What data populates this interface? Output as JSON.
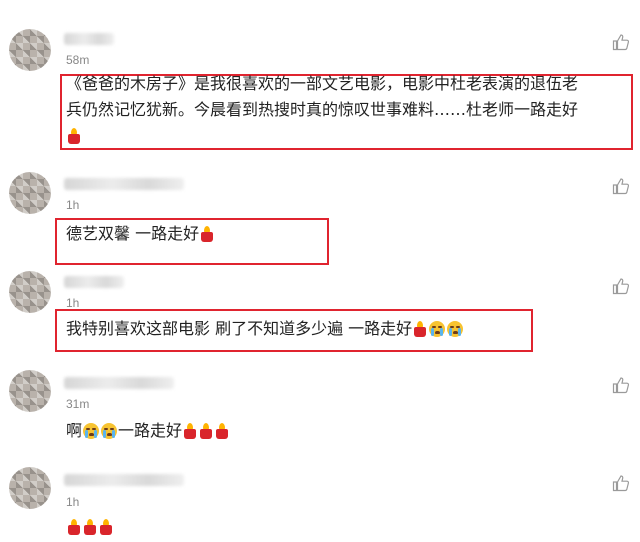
{
  "comments": [
    {
      "time": "58m",
      "lines": [
        "《爸爸的木房子》是我很喜欢的一部文艺电影，电影中杜老表演的退伍老",
        "兵仍然记忆犹新。今晨看到热搜时真的惊叹世事难料……杜老师一路走好"
      ],
      "emoji": [
        "candle"
      ]
    },
    {
      "time": "1h",
      "text": "德艺双馨 一路走好",
      "emoji": [
        "candle"
      ]
    },
    {
      "time": "1h",
      "text": "我特别喜欢这部电影 刷了不知道多少遍 一路走好",
      "emoji": [
        "candle",
        "crying-face",
        "crying-face"
      ]
    },
    {
      "time": "31m",
      "text_prefix": "啊",
      "text": "一路走好",
      "emoji_before": [
        "crying-face",
        "crying-face"
      ],
      "emoji": [
        "candle",
        "candle",
        "candle"
      ]
    },
    {
      "time": "1h",
      "text": "",
      "emoji": [
        "candle",
        "candle",
        "candle"
      ]
    }
  ],
  "colors": {
    "highlight_border": "#e0242f",
    "time_text": "#888888",
    "body_text": "#222222"
  }
}
